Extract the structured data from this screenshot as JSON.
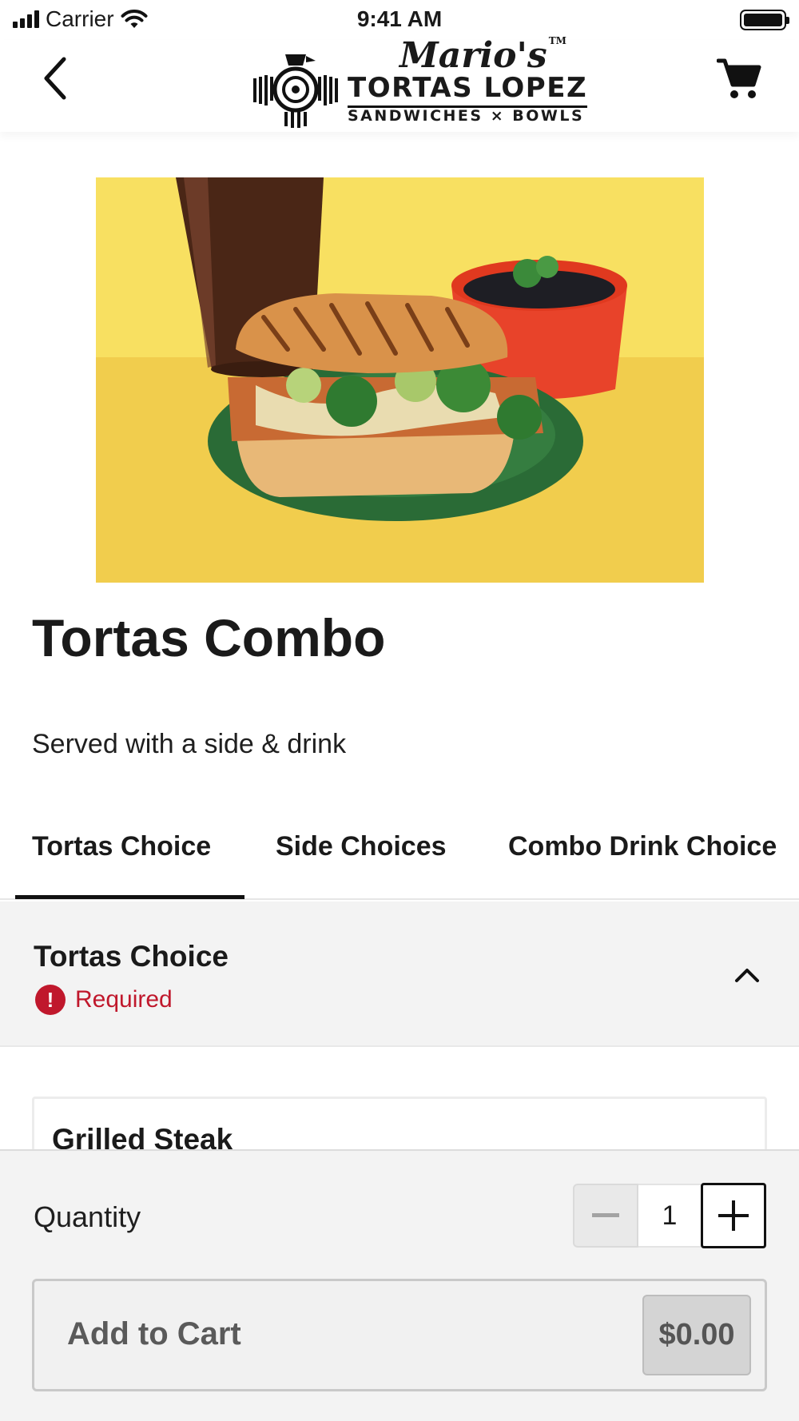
{
  "status_bar": {
    "carrier": "Carrier",
    "time": "9:41 AM"
  },
  "header": {
    "logo": {
      "script": "Mario's",
      "trademark": "TM",
      "name": "TORTAS LOPEZ",
      "tagline": "SANDWICHES × BOWLS"
    },
    "back_icon": "chevron-left-icon",
    "cart_icon": "shopping-cart-icon"
  },
  "product": {
    "image": "torta-combo-photo",
    "title": "Tortas Combo",
    "description": "Served with a side & drink"
  },
  "tabs": [
    {
      "label": "Tortas Choice",
      "active": true
    },
    {
      "label": "Side Choices",
      "active": false
    },
    {
      "label": "Combo Drink Choice",
      "active": false
    }
  ],
  "section": {
    "title": "Tortas Choice",
    "status_icon": "!",
    "status": "Required",
    "expanded": true
  },
  "options": [
    {
      "name": "Grilled Steak"
    }
  ],
  "footer": {
    "quantity_label": "Quantity",
    "quantity": "1",
    "add_to_cart_label": "Add to Cart",
    "price": "$0.00"
  },
  "colors": {
    "required": "#c0182c",
    "hero_background": "#f7dc5a",
    "plate": "#2e7a3c"
  }
}
